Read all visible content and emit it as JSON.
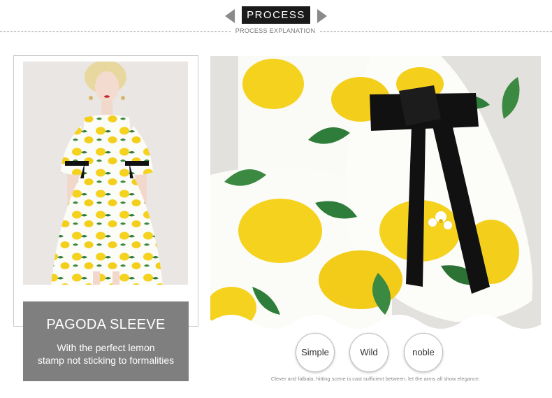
{
  "header": {
    "title": "PROCESS",
    "subtitle": "PROCESS EXPLANATION"
  },
  "feature": {
    "title": "PAGODA SLEEVE",
    "line1": "With the perfect lemon",
    "line2": "stamp not sticking to formalities"
  },
  "tags": [
    {
      "label": "Simple"
    },
    {
      "label": "Wild"
    },
    {
      "label": "noble"
    }
  ],
  "footnote": "Clever and falbala, hitting scene is cast sufficient between, let the arms all show elegance.",
  "colors": {
    "ribbon_dark": "#1a1a1a",
    "ribbon_tail": "#8a8a8a",
    "caption_bg": "#7f7f7f",
    "lemon_yellow": "#f5d21e",
    "leaf_green": "#2f7d3a",
    "bow_black": "#111111"
  }
}
